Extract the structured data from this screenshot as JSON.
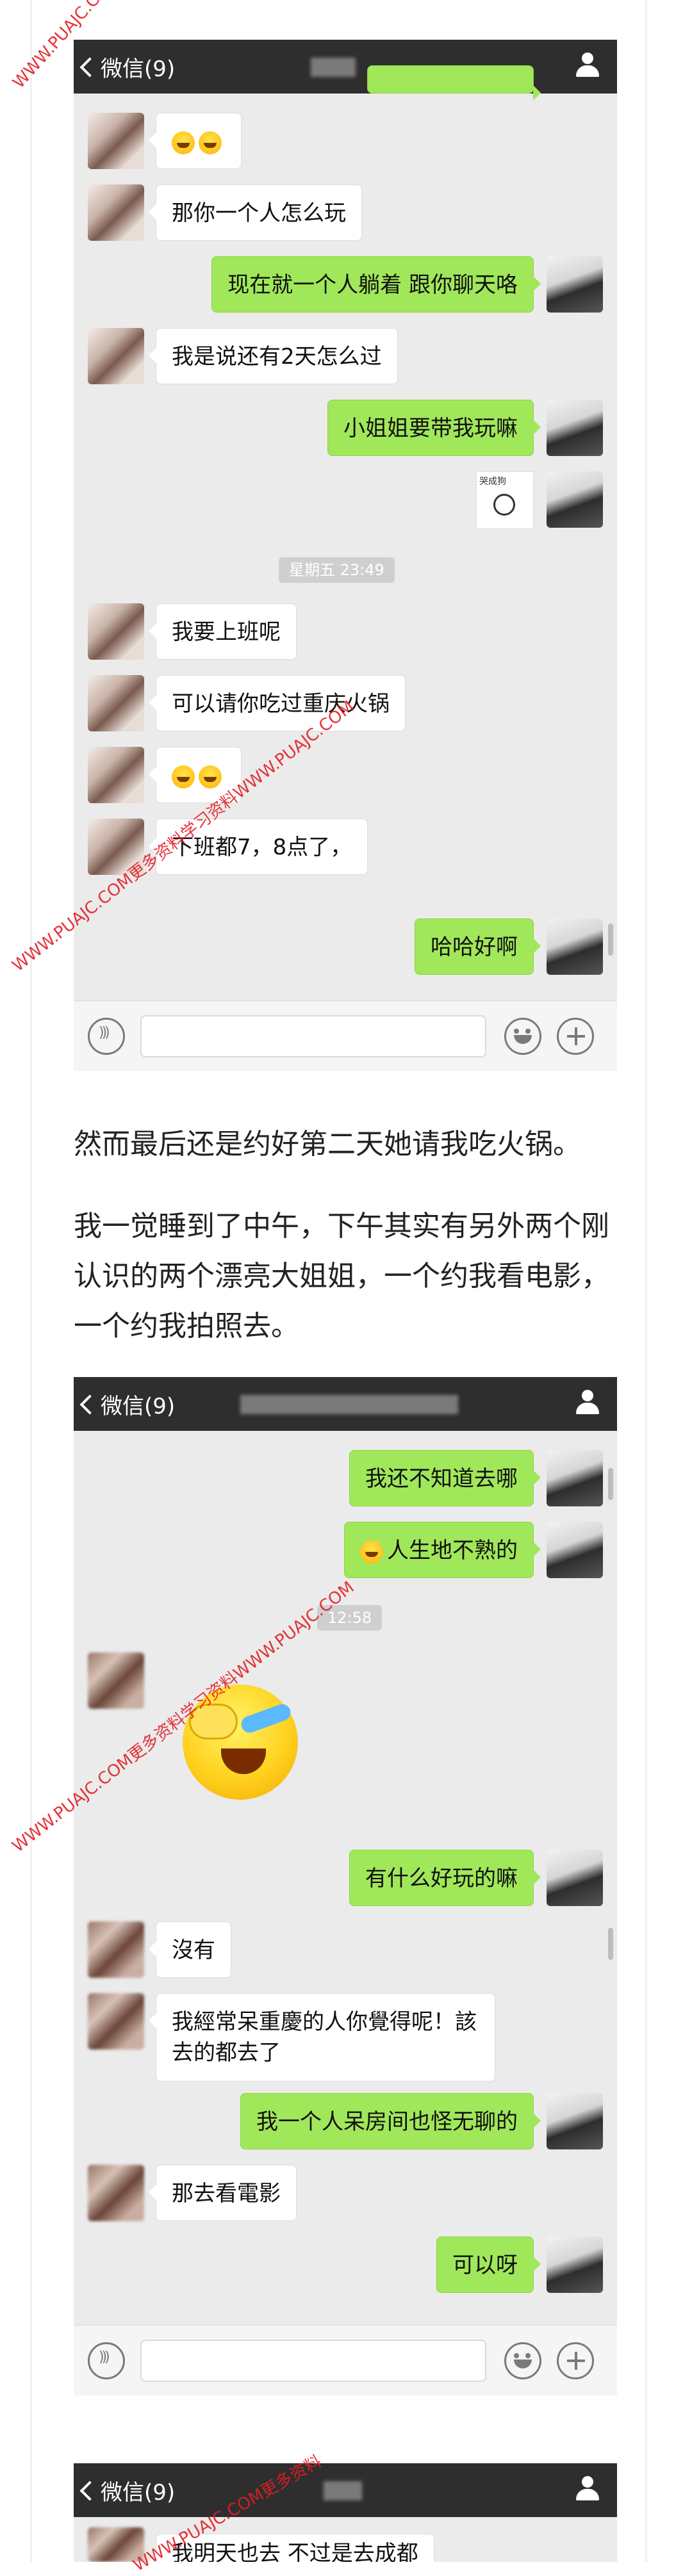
{
  "nav": {
    "back_label": "微信(9)"
  },
  "chat1": {
    "messages": {
      "m1": "",
      "m2": "那你一个人怎么玩",
      "m3": "现在就一个人躺着 跟你聊天咯",
      "m4": "我是说还有2天怎么过",
      "m5": "小姐姐要带我玩嘛",
      "m6_sticker_text": "哭成狗",
      "m7": "我要上班呢",
      "m8": "可以请你吃过重庆火锅",
      "m9": "",
      "m10": "下班都7，8点了，",
      "m11": "哈哈好啊"
    },
    "timestamp": "星期五 23:49"
  },
  "article": {
    "p1": "然而最后还是约好第二天她请我吃火锅。",
    "p2": "我一觉睡到了中午，下午其实有另外两个刚认识的两个漂亮大姐姐，一个约我看电影，一个约我拍照去。"
  },
  "chat2": {
    "messages": {
      "m1": "我还不知道去哪",
      "m2": "人生地不熟的",
      "m3": "有什么好玩的嘛",
      "m4": "沒有",
      "m5": "我經常呆重慶的人你覺得呢！該去的都去了",
      "m6": "我一个人呆房间也怪无聊的",
      "m7": "那去看電影",
      "m8": "可以呀"
    },
    "timestamp": "12:58"
  },
  "chat3": {
    "messages": {
      "m1": "我明天也去 不过是去成都"
    }
  },
  "watermarks": {
    "w1": "WWW.PUAJC.COM更多",
    "w2": "WWW.PUAJC.COM更多资料学习资料WWW.PUAJC.COM",
    "w3": "WWW.PUAJC.COM更多资料学习资料WWW.PUAJC.COM",
    "w4": "WWW.PUAJC.COM更多资料"
  },
  "icons": [
    "back-chevron-icon",
    "person-icon",
    "voice-icon",
    "emoji-icon",
    "plus-icon",
    "laughing-emoji-icon"
  ],
  "colors": {
    "navbar": "#2e2e2f",
    "chat_bg": "#ebebeb",
    "outgoing_bubble": "#a0e75a",
    "incoming_bubble": "#ffffff",
    "watermark": "#e31e24"
  }
}
